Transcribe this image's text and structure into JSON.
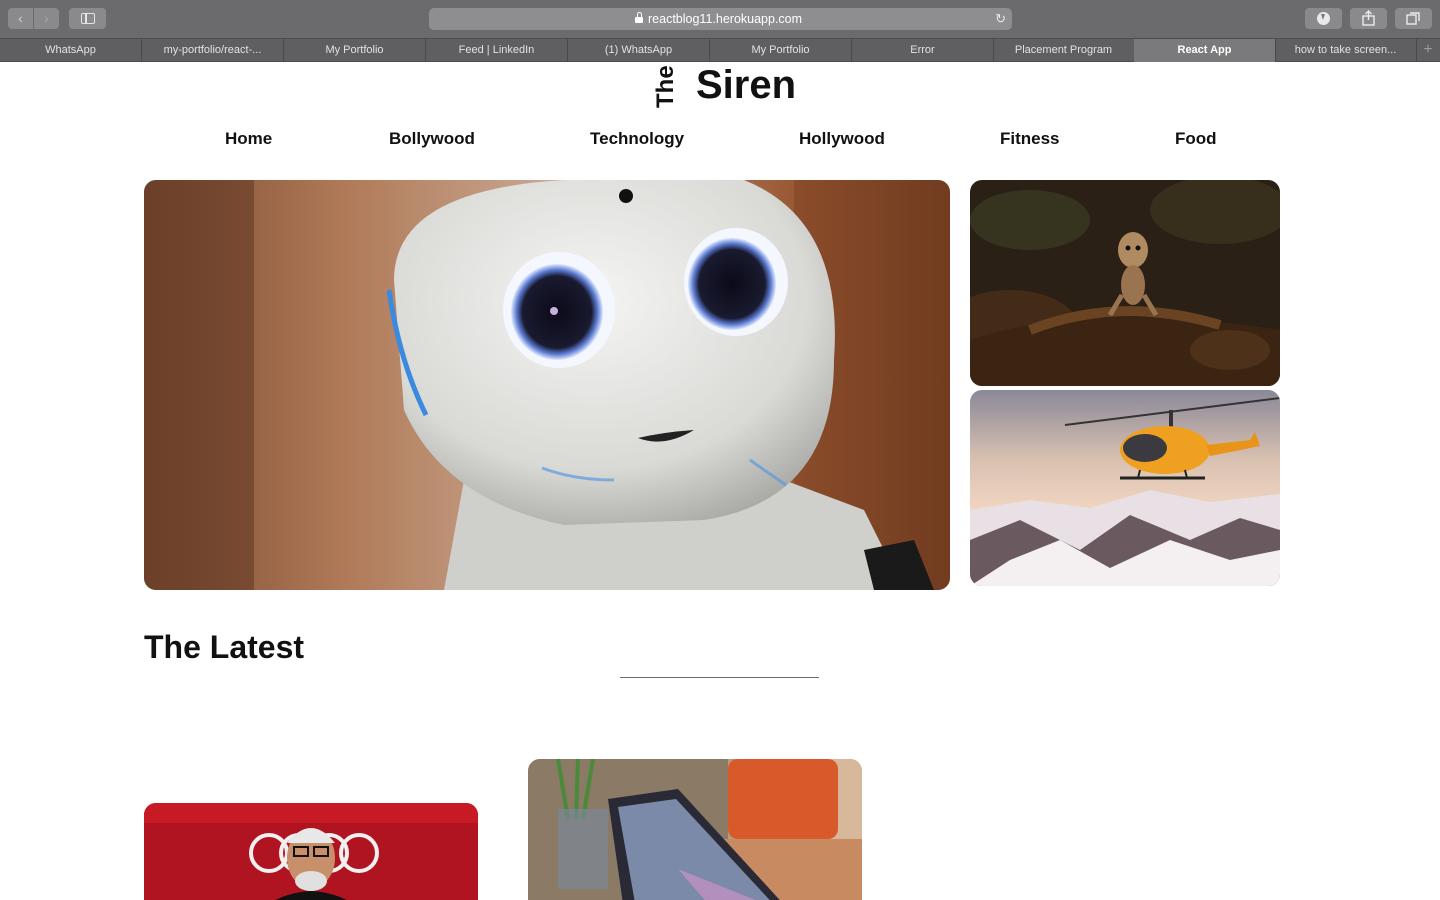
{
  "browser": {
    "url": "reactblog11.herokuapp.com",
    "tabs": [
      {
        "label": "WhatsApp",
        "active": false
      },
      {
        "label": "my-portfolio/react-...",
        "active": false
      },
      {
        "label": "My Portfolio",
        "active": false
      },
      {
        "label": "Feed | LinkedIn",
        "active": false
      },
      {
        "label": "(1) WhatsApp",
        "active": false
      },
      {
        "label": "My Portfolio",
        "active": false
      },
      {
        "label": "Error",
        "active": false
      },
      {
        "label": "Placement Program",
        "active": false
      },
      {
        "label": "React App",
        "active": true
      },
      {
        "label": "how to take screen...",
        "active": false
      }
    ],
    "icons": {
      "back": "chevron-left-icon",
      "forward": "chevron-right-icon",
      "sidebar": "sidebar-icon",
      "lock": "lock-icon",
      "reload": "reload-icon",
      "download": "download-icon",
      "share": "share-icon",
      "tabs": "tab-overview-icon",
      "new_tab": "plus-icon"
    }
  },
  "site": {
    "logo_the": "The",
    "logo_siren": "Siren",
    "nav": [
      "Home",
      "Bollywood",
      "Technology",
      "Hollywood",
      "Fitness",
      "Food"
    ],
    "latest_heading": "The Latest"
  },
  "images": {
    "hero": "robot-photo",
    "side_top": "groot-figure-photo",
    "side_bottom": "helicopter-photo",
    "card1": "amitabh-bachchan-photo",
    "card2": "tablet-on-table-photo"
  }
}
